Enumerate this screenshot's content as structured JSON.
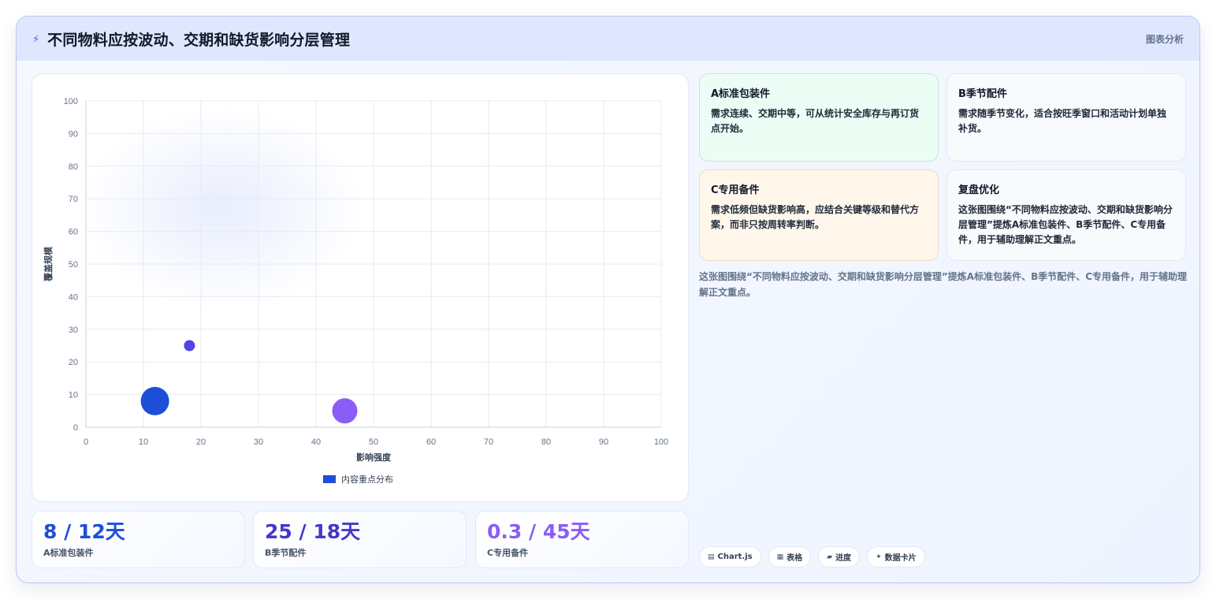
{
  "header": {
    "icon": "lightning-icon",
    "title": "不同物料应按波动、交期和缺货影响分层管理",
    "tag": "图表分析"
  },
  "chart_data": {
    "type": "bubble",
    "xlabel": "影响强度",
    "ylabel": "覆盖规模",
    "xlim": [
      0,
      100
    ],
    "ylim": [
      0,
      100
    ],
    "xticks": [
      0,
      10,
      20,
      30,
      40,
      50,
      60,
      70,
      80,
      90,
      100
    ],
    "yticks": [
      0,
      10,
      20,
      30,
      40,
      50,
      60,
      70,
      80,
      90,
      100
    ],
    "grid": true,
    "legend_position": "bottom",
    "series": [
      {
        "name": "内容重点分布",
        "color": "#1d4ed8",
        "points": [
          {
            "x": 12,
            "y": 8,
            "r": 18,
            "color": "#1d4ed8"
          },
          {
            "x": 18,
            "y": 25,
            "r": 7,
            "color": "#4f46e5"
          },
          {
            "x": 45,
            "y": 5,
            "r": 16,
            "color": "#8b5cf6"
          }
        ]
      }
    ]
  },
  "stats": [
    {
      "value": "8 / 12天",
      "label": "A标准包装件",
      "color": "#1d4ed8"
    },
    {
      "value": "25 / 18天",
      "label": "B季节配件",
      "color": "#4338ca"
    },
    {
      "value": "0.3 / 45天",
      "label": "C专用备件",
      "color": "#8b5cf6"
    }
  ],
  "cards": [
    {
      "title": "A标准包装件",
      "text": "需求连续、交期中等，可从统计安全库存与再订货点开始。",
      "bg": "#ecfdf5",
      "border": "#bfe9d6"
    },
    {
      "title": "B季节配件",
      "text": "需求随季节变化，适合按旺季窗口和活动计划单独补货。",
      "bg": "#f8fafd",
      "border": "#e3e8f2"
    },
    {
      "title": "C专用备件",
      "text": "需求低频但缺货影响高，应结合关键等级和替代方案，而非只按周转率判断。",
      "bg": "#fff7ec",
      "border": "#f3dcb8"
    },
    {
      "title": "复盘优化",
      "text": "这张图围绕“不同物料应按波动、交期和缺货影响分层管理”提炼A标准包装件、B季节配件、C专用备件，用于辅助理解正文重点。",
      "bg": "#f8fafd",
      "border": "#e3e8f2"
    }
  ],
  "summary": "这张图围绕“不同物料应按波动、交期和缺货影响分层管理”提炼A标准包装件、B季节配件、C专用备件，用于辅助理解正文重点。",
  "chips": [
    {
      "icon": "chart-icon",
      "label": "Chart.js"
    },
    {
      "icon": "table-icon",
      "label": "表格"
    },
    {
      "icon": "progress-icon",
      "label": "进度"
    },
    {
      "icon": "sparkle-icon",
      "label": "数据卡片"
    }
  ]
}
